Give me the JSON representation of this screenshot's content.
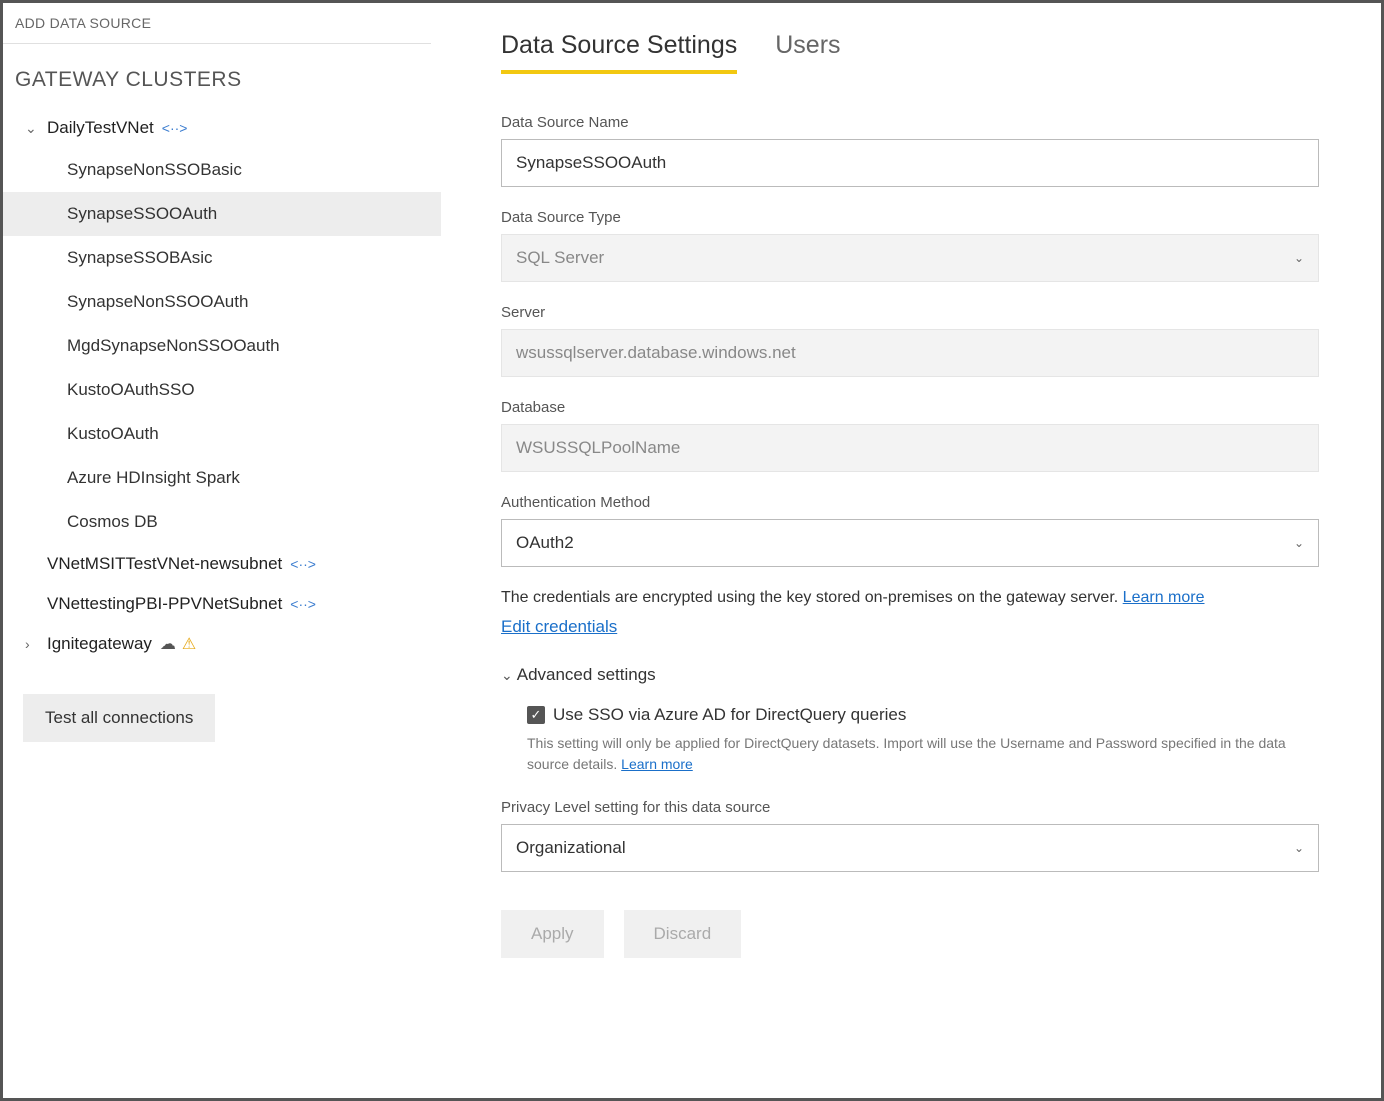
{
  "sidebar": {
    "add_label": "ADD DATA SOURCE",
    "section_title": "GATEWAY CLUSTERS",
    "clusters": [
      {
        "name": "DailyTestVNet",
        "expanded": true,
        "has_link_icon": true,
        "data_sources": [
          "SynapseNonSSOBasic",
          "SynapseSSOOAuth",
          "SynapseSSOBAsic",
          "SynapseNonSSOOAuth",
          "MgdSynapseNonSSOOauth",
          "KustoOAuthSSO",
          "KustoOAuth",
          "Azure HDInsight Spark",
          "Cosmos DB"
        ],
        "selected_index": 1
      },
      {
        "name": "VNetMSITTestVNet-newsubnet",
        "expanded": false,
        "has_link_icon": true,
        "leaf": true
      },
      {
        "name": "VNettestingPBI-PPVNetSubnet",
        "expanded": false,
        "has_link_icon": true,
        "leaf": true
      },
      {
        "name": "Ignitegateway",
        "expanded": false,
        "has_cloud_icon": true,
        "has_warn_icon": true
      }
    ],
    "test_button": "Test all connections"
  },
  "tabs": {
    "settings": "Data Source Settings",
    "users": "Users",
    "active": "settings"
  },
  "form": {
    "name_label": "Data Source Name",
    "name_value": "SynapseSSOOAuth",
    "type_label": "Data Source Type",
    "type_value": "SQL Server",
    "server_label": "Server",
    "server_value": "wsussqlserver.database.windows.net",
    "database_label": "Database",
    "database_value": "WSUSSQLPoolName",
    "auth_label": "Authentication Method",
    "auth_value": "OAuth2",
    "cred_info": "The credentials are encrypted using the key stored on-premises on the gateway server.",
    "learn_more": "Learn more",
    "edit_credentials": "Edit credentials",
    "advanced_label": "Advanced settings",
    "sso_checkbox": "Use SSO via Azure AD for DirectQuery queries",
    "sso_help": "This setting will only be applied for DirectQuery datasets. Import will use the Username and Password specified in the data source details.",
    "privacy_label": "Privacy Level setting for this data source",
    "privacy_value": "Organizational",
    "apply": "Apply",
    "discard": "Discard"
  }
}
